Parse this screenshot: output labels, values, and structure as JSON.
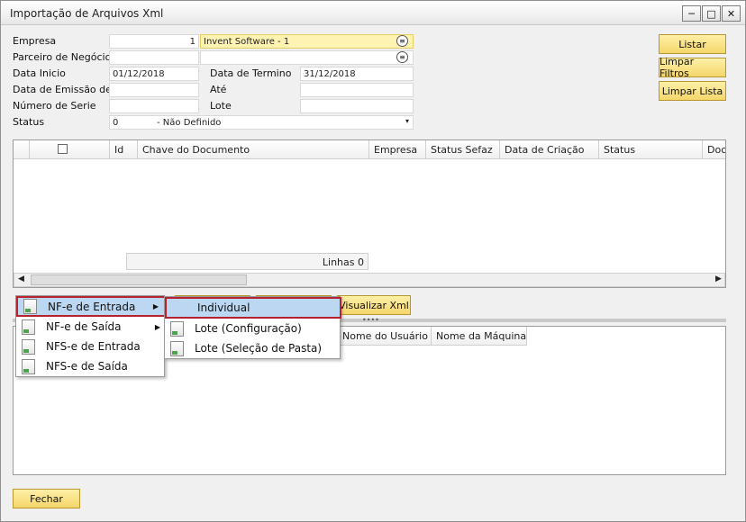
{
  "window": {
    "title": "Importação de Arquivos Xml"
  },
  "form": {
    "empresa_label": "Empresa",
    "empresa_code": "1",
    "empresa_name": "Invent Software - 1",
    "parceiro_label": "Parceiro de Negócios",
    "data_inicio_label": "Data Inicio",
    "data_inicio_value": "01/12/2018",
    "data_termino_label": "Data de Termino",
    "data_termino_value": "31/12/2018",
    "data_emissao_label": "Data de Emissão de",
    "ate_label": "Até",
    "numero_serie_label": "Número de Serie",
    "lote_label": "Lote",
    "status_label": "Status",
    "status_code": "0",
    "status_value": "- Não Definido"
  },
  "buttons": {
    "listar": "Listar",
    "limpar_filtros": "Limpar Filtros",
    "limpar_lista": "Limpar Lista",
    "visualizar_xml": "Visualizar Xml",
    "fechar": "Fechar"
  },
  "grid": {
    "columns": [
      "Id",
      "Chave do Documento",
      "Empresa",
      "Status Sefaz",
      "Data de Criação",
      "Status",
      "Docu"
    ],
    "footer": "Linhas 0"
  },
  "lower_grid": {
    "columns": [
      "Nome do Usuário",
      "Nome da Máquina"
    ]
  },
  "menu": {
    "items": [
      "NF-e de Entrada",
      "NF-e de Saída",
      "NFS-e de Entrada",
      "NFS-e de Saída"
    ],
    "submenu": [
      "Individual",
      "Lote (Configuração)",
      "Lote (Seleção de Pasta)"
    ]
  }
}
